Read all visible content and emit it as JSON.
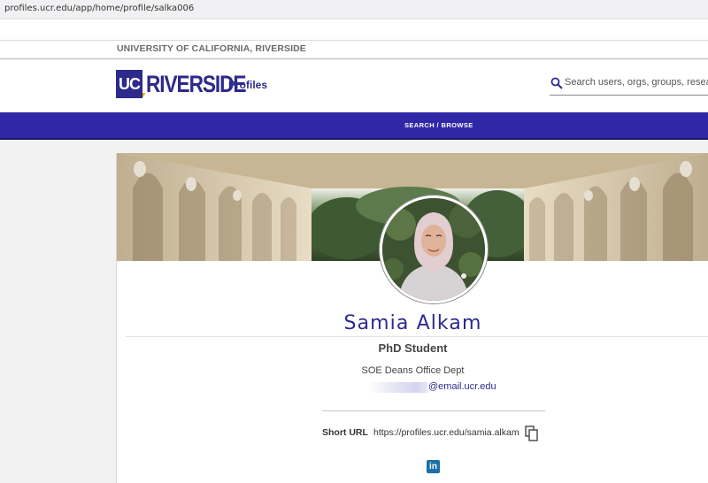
{
  "browser": {
    "url": "profiles.ucr.edu/app/home/profile/salka006"
  },
  "university_bar": {
    "text": "UNIVERSITY OF CALIFORNIA, RIVERSIDE"
  },
  "header": {
    "logo": {
      "uc": "UC",
      "riverside": "RIVERSIDE",
      "profiles": "Profiles"
    },
    "search": {
      "placeholder": "Search users, orgs, groups, research..."
    }
  },
  "nav": {
    "search_browse": "SEARCH / BROWSE"
  },
  "profile": {
    "name": "Samia Alkam",
    "title": "PhD Student",
    "department": "SOE Deans Office Dept",
    "email_domain": "@email.ucr.edu",
    "short_url_label": "Short URL",
    "short_url": "https://profiles.ucr.edu/samia.alkam",
    "linkedin_glyph": "in"
  },
  "colors": {
    "brand_blue": "#2d2a8c",
    "nav_blue": "#2f28a6",
    "brand_gold": "#f1ab00",
    "linkedin_blue": "#1d6fa5"
  }
}
